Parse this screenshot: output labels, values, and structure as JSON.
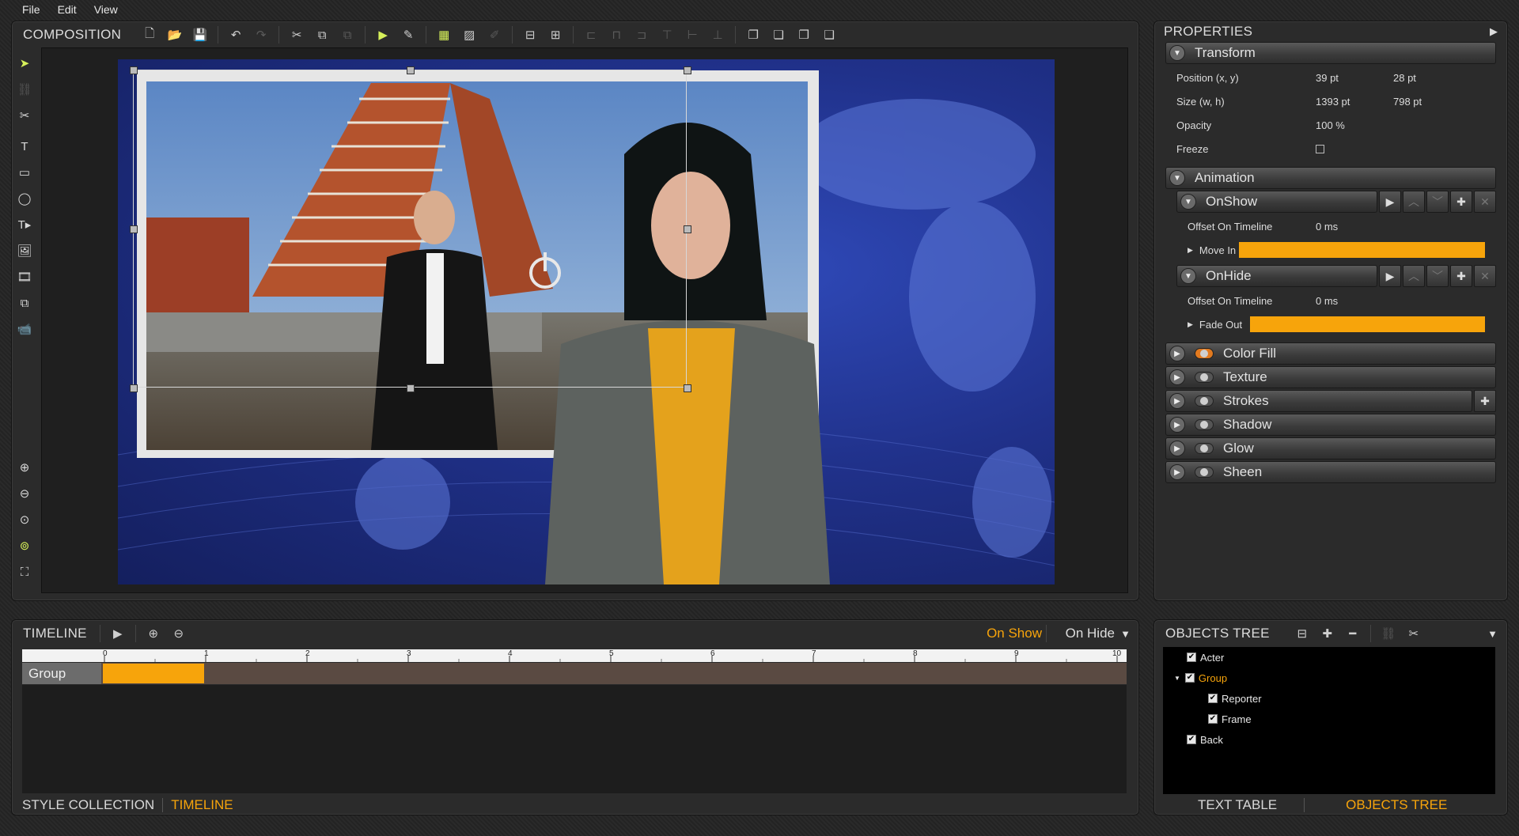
{
  "menu": [
    "File",
    "Edit",
    "View"
  ],
  "composition": {
    "title": "COMPOSITION",
    "toolbar_icons": [
      "new-icon",
      "open-icon",
      "save-icon",
      "undo-icon",
      "redo-icon",
      "cut-icon",
      "copy-icon",
      "paste-icon",
      "play-icon",
      "edit-icon",
      "image-icon",
      "image-edit-icon",
      "pencil-icon",
      "fit-width-icon",
      "fit-icon",
      "align-left-icon",
      "align-center-icon",
      "align-right-icon",
      "align-top-icon",
      "align-middle-icon",
      "align-bottom-icon",
      "bring-front-icon",
      "send-back-icon",
      "bring-forward-icon",
      "send-backward-icon"
    ]
  },
  "tools": [
    "pointer-icon",
    "link-icon",
    "unlink-icon",
    "text-icon",
    "rectangle-icon",
    "ellipse-icon",
    "ticker-icon",
    "image-icon",
    "video-icon",
    "clone-icon",
    "camera-icon",
    "zoom-in-icon",
    "zoom-out-icon",
    "zoom-fit-icon",
    "zoom-actual-icon",
    "fit-screen-icon"
  ],
  "properties": {
    "title": "PROPERTIES",
    "transform": {
      "label": "Transform",
      "position_label": "Position (x, y)",
      "position_x": "39 pt",
      "position_y": "28 pt",
      "size_label": "Size (w, h)",
      "size_w": "1393 pt",
      "size_h": "798 pt",
      "opacity_label": "Opacity",
      "opacity": "100 %",
      "freeze_label": "Freeze"
    },
    "animation": {
      "label": "Animation",
      "onshow": {
        "label": "OnShow",
        "offset_label": "Offset On Timeline",
        "offset": "0 ms",
        "effect": "Move In"
      },
      "onhide": {
        "label": "OnHide",
        "offset_label": "Offset On Timeline",
        "offset": "0 ms",
        "effect": "Fade Out"
      }
    },
    "sections": [
      "Color Fill",
      "Texture",
      "Strokes",
      "Shadow",
      "Glow",
      "Sheen"
    ]
  },
  "timeline": {
    "title": "TIMELINE",
    "on_show": "On Show",
    "on_hide": "On Hide",
    "ticks": [
      "0",
      "1",
      "2",
      "3",
      "4",
      "5",
      "6",
      "7",
      "8",
      "9",
      "10"
    ],
    "row_label": "Group"
  },
  "bottom_tabs_left": {
    "style_collection": "STYLE COLLECTION",
    "timeline": "TIMELINE"
  },
  "objects_tree": {
    "title": "OBJECTS TREE",
    "items": {
      "acter": "Acter",
      "group": "Group",
      "reporter": "Reporter",
      "frame": "Frame",
      "back": "Back"
    }
  },
  "bottom_tabs_right": {
    "text_table": "TEXT TABLE",
    "objects_tree": "OBJECTS TREE"
  },
  "colors": {
    "accent": "#f7a40b",
    "highlight": "#d6f05a"
  }
}
